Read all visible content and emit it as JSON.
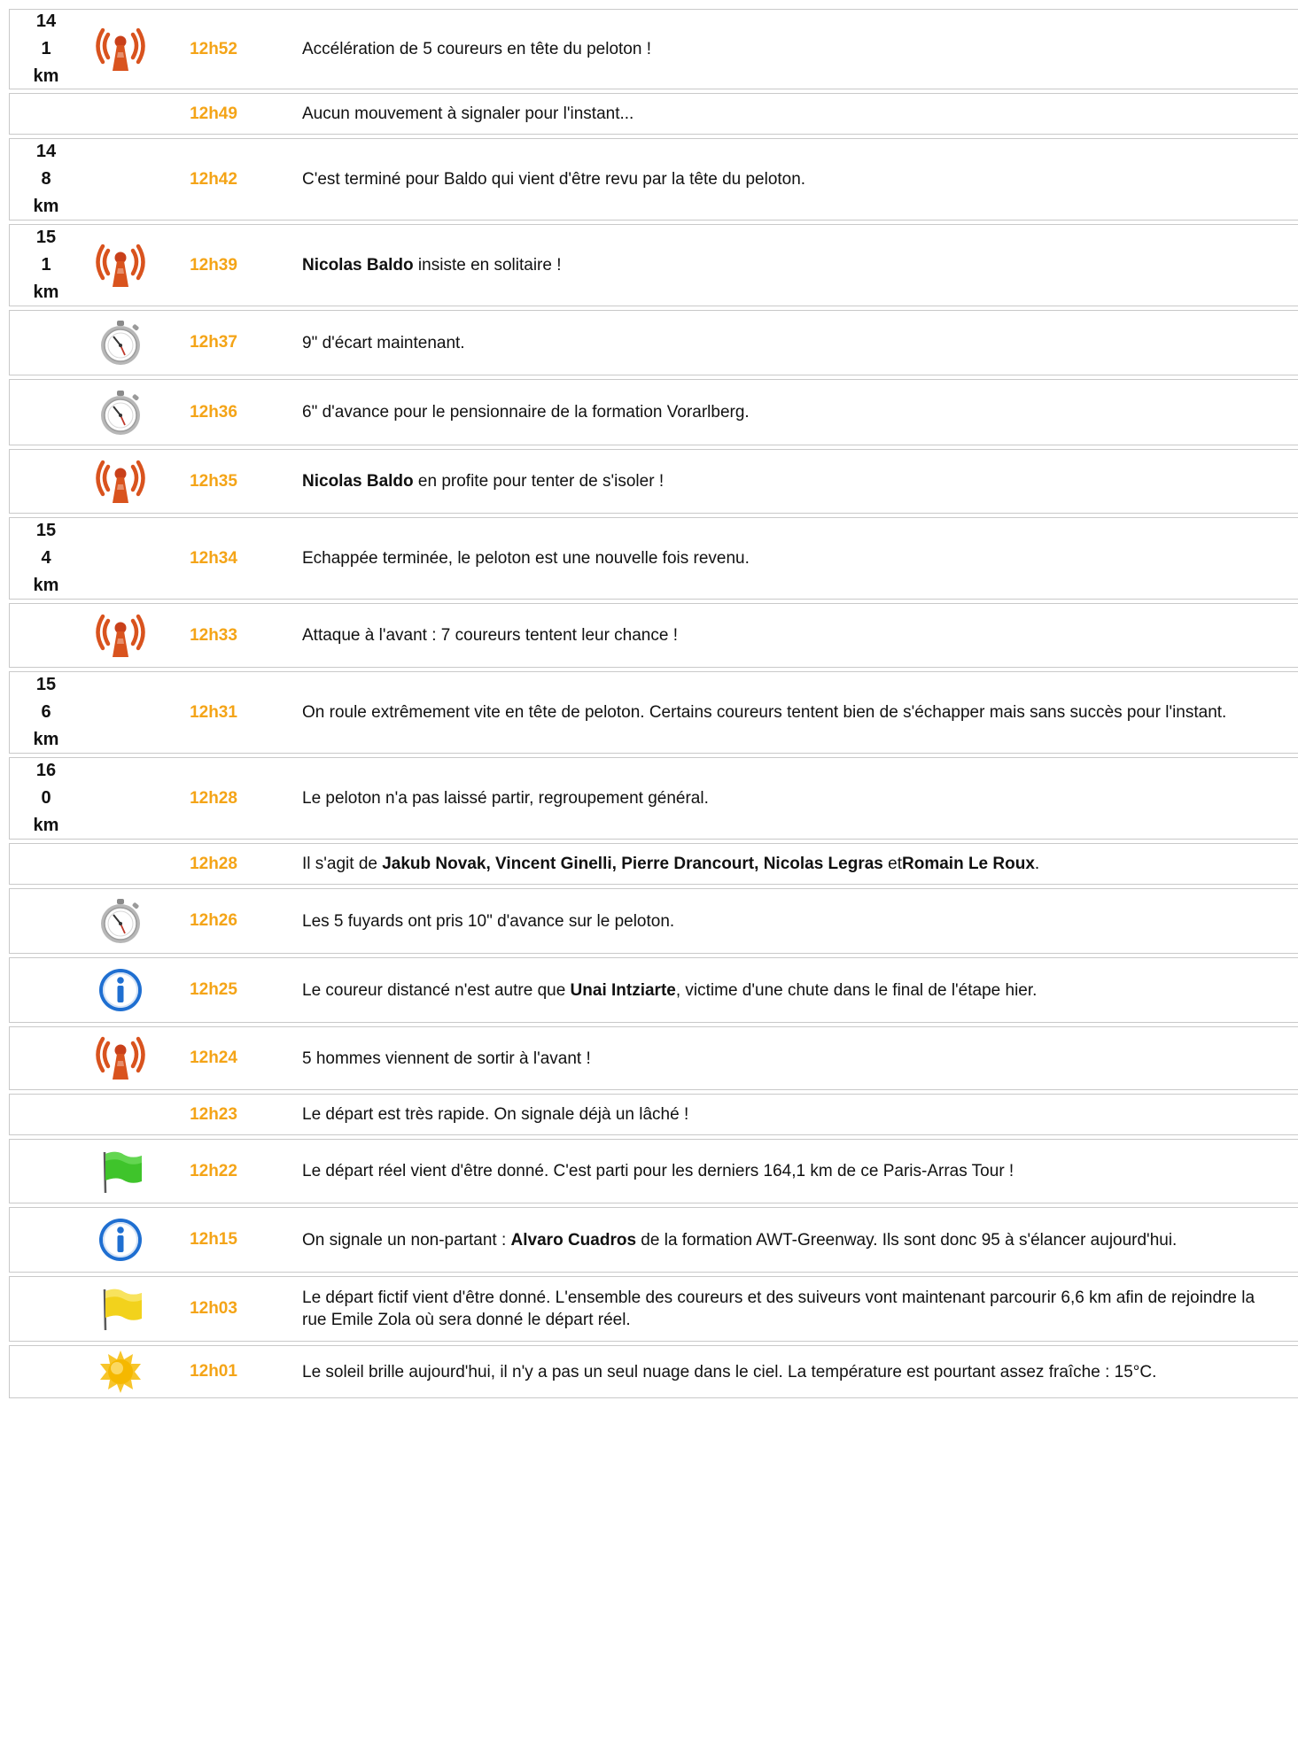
{
  "entries": [
    {
      "km": [
        "14",
        "1",
        "km"
      ],
      "icon": "antenna-icon",
      "time": "12h52",
      "text": [
        {
          "t": "Accélération de 5 coureurs en tête du peloton !"
        }
      ]
    },
    {
      "km": [],
      "icon": "",
      "time": "12h49",
      "text": [
        {
          "t": "Aucun mouvement à signaler pour l'instant..."
        }
      ]
    },
    {
      "km": [
        "14",
        "8",
        "km"
      ],
      "icon": "",
      "time": "12h42",
      "text": [
        {
          "t": "C'est terminé pour Baldo qui vient d'être revu par la tête du peloton."
        }
      ]
    },
    {
      "km": [
        "15",
        "1",
        "km"
      ],
      "icon": "antenna-icon",
      "time": "12h39",
      "text": [
        {
          "t": "Nicolas Baldo",
          "b": true
        },
        {
          "t": " insiste en solitaire !"
        }
      ]
    },
    {
      "km": [],
      "icon": "stopwatch-icon",
      "time": "12h37",
      "text": [
        {
          "t": "9\" d'écart maintenant."
        }
      ]
    },
    {
      "km": [],
      "icon": "stopwatch-icon",
      "time": "12h36",
      "text": [
        {
          "t": "6\" d'avance pour le pensionnaire de la formation Vorarlberg."
        }
      ]
    },
    {
      "km": [],
      "icon": "antenna-icon",
      "time": "12h35",
      "text": [
        {
          "t": "Nicolas Baldo",
          "b": true
        },
        {
          "t": " en profite pour tenter de s'isoler !"
        }
      ]
    },
    {
      "km": [
        "15",
        "4",
        "km"
      ],
      "icon": "",
      "time": "12h34",
      "text": [
        {
          "t": "Echappée terminée, le peloton est une nouvelle fois revenu."
        }
      ]
    },
    {
      "km": [],
      "icon": "antenna-icon",
      "time": "12h33",
      "text": [
        {
          "t": "Attaque à l'avant : 7 coureurs tentent leur chance !"
        }
      ]
    },
    {
      "km": [
        "15",
        "6",
        "km"
      ],
      "icon": "",
      "time": "12h31",
      "text": [
        {
          "t": "On roule extrêmement vite en tête de peloton. Certains coureurs tentent bien de s'échapper mais sans succès pour l'instant."
        }
      ]
    },
    {
      "km": [
        "16",
        "0",
        "km"
      ],
      "icon": "",
      "time": "12h28",
      "text": [
        {
          "t": "Le peloton n'a pas laissé partir, regroupement général."
        }
      ]
    },
    {
      "km": [],
      "icon": "",
      "time": "12h28",
      "text": [
        {
          "t": "Il s'agit de "
        },
        {
          "t": "Jakub Novak, Vincent Ginelli, Pierre Drancourt, Nicolas Legras",
          "b": true
        },
        {
          "t": " et"
        },
        {
          "t": "Romain Le Roux",
          "b": true
        },
        {
          "t": "."
        }
      ]
    },
    {
      "km": [],
      "icon": "stopwatch-icon",
      "time": "12h26",
      "text": [
        {
          "t": "Les 5 fuyards ont pris 10\" d'avance sur le peloton."
        }
      ]
    },
    {
      "km": [],
      "icon": "info-icon",
      "time": "12h25",
      "text": [
        {
          "t": "Le coureur distancé n'est autre que "
        },
        {
          "t": "Unai Intziarte",
          "b": true
        },
        {
          "t": ", victime d'une chute dans le final de l'étape hier."
        }
      ]
    },
    {
      "km": [],
      "icon": "antenna-icon",
      "time": "12h24",
      "text": [
        {
          "t": "5 hommes viennent de sortir à l'avant !"
        }
      ]
    },
    {
      "km": [],
      "icon": "",
      "time": "12h23",
      "text": [
        {
          "t": "Le départ est très rapide. On signale déjà un lâché !"
        }
      ]
    },
    {
      "km": [],
      "icon": "green-flag-icon",
      "time": "12h22",
      "text": [
        {
          "t": "Le départ réel vient d'être donné. C'est parti pour les derniers 164,1 km de ce Paris-Arras Tour !"
        }
      ]
    },
    {
      "km": [],
      "icon": "info-icon",
      "time": "12h15",
      "text": [
        {
          "t": "On signale un non-partant : "
        },
        {
          "t": "Alvaro Cuadros",
          "b": true
        },
        {
          "t": " de la formation AWT-Greenway. Ils sont donc 95 à s'élancer aujourd'hui."
        }
      ]
    },
    {
      "km": [],
      "icon": "yellow-flag-icon",
      "time": "12h03",
      "text": [
        {
          "t": "Le départ fictif vient d'être donné. L'ensemble des coureurs et des suiveurs vont maintenant parcourir 6,6 km afin de rejoindre la rue Emile Zola où sera donné le départ réel."
        }
      ]
    },
    {
      "km": [],
      "icon": "sun-icon",
      "time": "12h01",
      "text": [
        {
          "t": "Le soleil brille aujourd'hui, il n'y a pas un seul nuage dans le ciel.  La température est pourtant assez fraîche : 15°C."
        }
      ]
    }
  ],
  "colors": {
    "time": "#f4a417",
    "border": "#c9c9c9",
    "antenna": "#d9531e",
    "info": "#1f6fd1",
    "green_flag": "#3fc42b",
    "yellow_flag": "#f2d21c",
    "sun": "#f5b800"
  }
}
